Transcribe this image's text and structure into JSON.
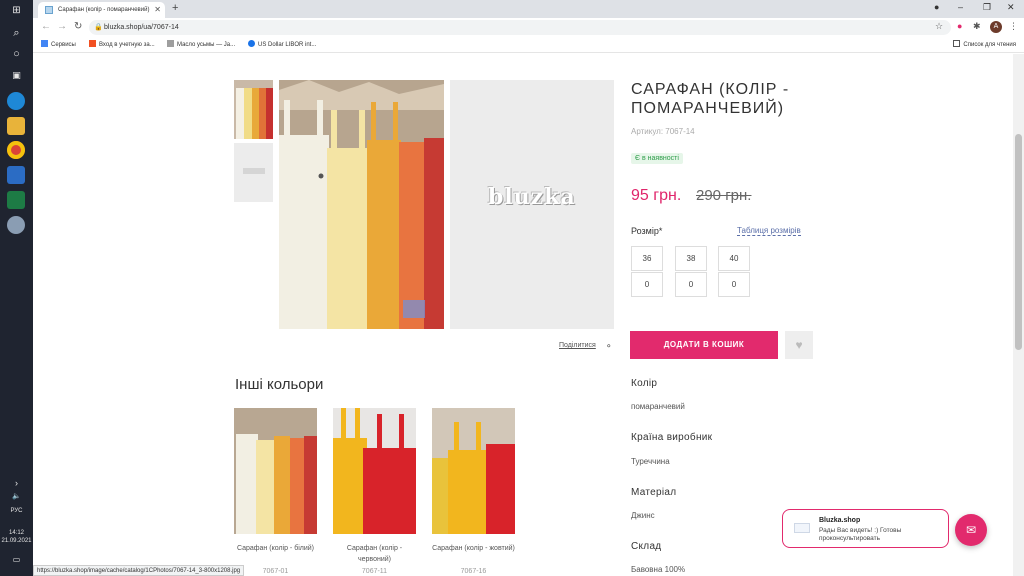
{
  "browser": {
    "tab_title": "Сарафан (колір - помаранчевий)",
    "url": "bluzka.shop/ua/7067-14",
    "bookmarks": [
      "Сервисы",
      "Вход в учетную за...",
      "Масло усьмы — Ja...",
      "US Dollar LIBOR int..."
    ],
    "reading_list": "Список для чтения",
    "status_url": "https://bluzka.shop/image/cache/catalog/1CPhotos/7067-14_3-800x1208.jpg"
  },
  "taskbar": {
    "lang": "РУС",
    "time": "14:12",
    "date": "21.09.2021"
  },
  "product": {
    "title": "САРАФАН (КОЛІР - ПОМАРАНЧЕВИЙ)",
    "sku": "Артикул: 7067-14",
    "stock": "Є в наявності",
    "price": "95 грн.",
    "old_price": "290 грн.",
    "size_label": "Розмір*",
    "size_table": "Таблиця розмірів",
    "sizes": [
      "36",
      "38",
      "40"
    ],
    "quantities": [
      "0",
      "0",
      "0"
    ],
    "add_to_cart": "ДОДАТИ В КОШИК",
    "share": "Поділитися",
    "placeholder_logo": "bluzka"
  },
  "attributes": [
    {
      "label": "Колір",
      "value": "помаранчевий"
    },
    {
      "label": "Країна виробник",
      "value": "Туреччина"
    },
    {
      "label": "Матеріал",
      "value": "Джинс"
    },
    {
      "label": "Склад",
      "value": "Бавовна 100%"
    }
  ],
  "other_colors": {
    "heading": "Інші кольори",
    "items": [
      {
        "name": "Сарафан (колір - білий)",
        "sku": "7067-01"
      },
      {
        "name": "Сарафан (колір - червоний)",
        "sku": "7067-11"
      },
      {
        "name": "Сарафан (колір - жовтий)",
        "sku": "7067-16"
      }
    ]
  },
  "chat": {
    "title": "Bluzka.shop",
    "text": "Рады Вас видеть! :) Готовы проконсультировать"
  },
  "colors": {
    "accent": "#e22a6d",
    "in_stock": "#2e9d4a"
  }
}
